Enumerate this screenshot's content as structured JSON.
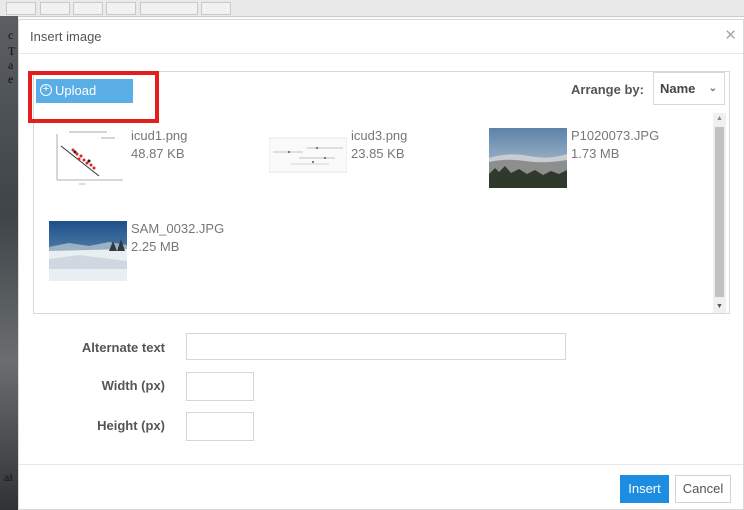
{
  "background": {
    "left_snippets": [
      "c",
      "T",
      "a",
      "e",
      "ai"
    ]
  },
  "dialog": {
    "title": "Insert image",
    "close_icon": "close-icon"
  },
  "toolbar": {
    "upload_label": "Upload",
    "arrange_label": "Arrange by:",
    "arrange_value": "Name"
  },
  "files": [
    {
      "name": "icud1.png",
      "size": "48.87 KB",
      "thumb": "chart-thumbnail"
    },
    {
      "name": "icud3.png",
      "size": "23.85 KB",
      "thumb": "diagram-thumbnail"
    },
    {
      "name": "P1020073.JPG",
      "size": "1.73 MB",
      "thumb": "landscape-photo"
    },
    {
      "name": "SAM_0032.JPG",
      "size": "2.25 MB",
      "thumb": "snow-photo"
    }
  ],
  "form": {
    "alt_label": "Alternate text",
    "alt_value": "",
    "width_label": "Width (px)",
    "width_value": "",
    "height_label": "Height (px)",
    "height_value": ""
  },
  "footer": {
    "insert_label": "Insert",
    "cancel_label": "Cancel"
  },
  "colors": {
    "primary": "#1c8de0",
    "upload": "#5aaee6",
    "highlight": "#e41d1d"
  }
}
